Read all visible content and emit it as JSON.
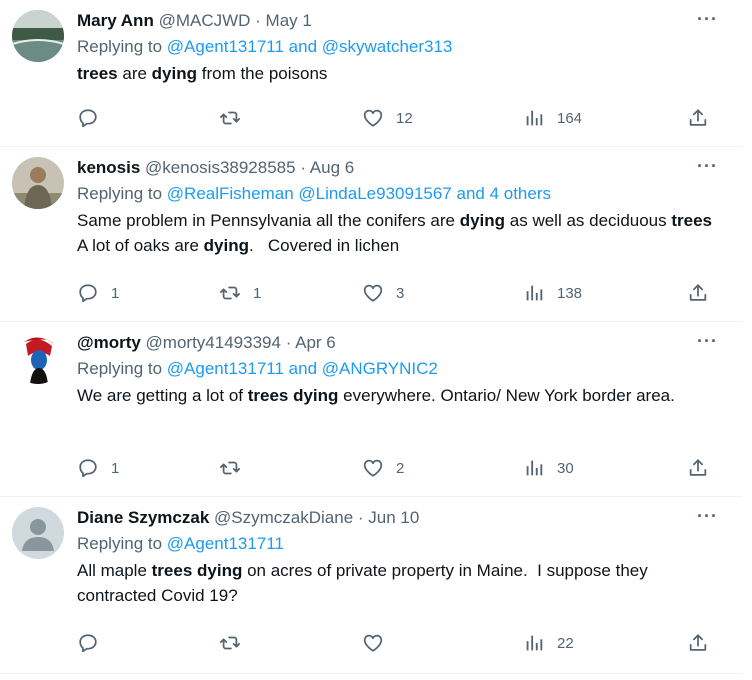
{
  "tweets": [
    {
      "name": "Mary Ann",
      "handle": "@MACJWD",
      "date": "· May 1",
      "replying_label": "Replying to ",
      "replying_to": "@Agent131711 and @skywatcher313",
      "text_parts": [
        {
          "t": "trees",
          "bold": true
        },
        {
          "t": " are ",
          "bold": false
        },
        {
          "t": "dying",
          "bold": true
        },
        {
          "t": " from the poisons",
          "bold": false
        }
      ],
      "counts": {
        "replies": "",
        "retweets": "",
        "likes": "12",
        "views": "164"
      },
      "avatar_style": "landscape"
    },
    {
      "name": "kenosis",
      "handle": "@kenosis38928585",
      "date": "· Aug 6",
      "replying_label": "Replying to ",
      "replying_to": "@RealFisheman @LindaLe93091567 and 4 others",
      "text_parts": [
        {
          "t": "Same problem in Pennsylvania all the conifers are ",
          "bold": false
        },
        {
          "t": "dying",
          "bold": true
        },
        {
          "t": " as well as deciduous ",
          "bold": false
        },
        {
          "t": "trees",
          "bold": true
        },
        {
          "t": "    A lot of oaks are ",
          "bold": false
        },
        {
          "t": "dying",
          "bold": true
        },
        {
          "t": ".   Covered in lichen",
          "bold": false
        }
      ],
      "counts": {
        "replies": "1",
        "retweets": "1",
        "likes": "3",
        "views": "138"
      },
      "avatar_style": "person"
    },
    {
      "name": "@morty",
      "handle": "@morty41493394",
      "date": "· Apr 6",
      "replying_label": "Replying to ",
      "replying_to": "@Agent131711 and @ANGRYNIC2",
      "text_parts": [
        {
          "t": "We are getting a lot of ",
          "bold": false
        },
        {
          "t": "trees dying",
          "bold": true
        },
        {
          "t": " everywhere. Ontario/ New York border area.",
          "bold": false
        }
      ],
      "counts": {
        "replies": "1",
        "retweets": "",
        "likes": "2",
        "views": "30"
      },
      "avatar_style": "character"
    },
    {
      "name": "Diane Szymczak",
      "handle": "@SzymczakDiane",
      "date": "· Jun 10",
      "replying_label": "Replying to ",
      "replying_to": "@Agent131711",
      "text_parts": [
        {
          "t": "All maple ",
          "bold": false
        },
        {
          "t": "trees dying",
          "bold": true
        },
        {
          "t": " on acres of private property in Maine.  I suppose they contracted Covid 19?",
          "bold": false
        }
      ],
      "counts": {
        "replies": "",
        "retweets": "",
        "likes": "",
        "views": "22"
      },
      "avatar_style": "default"
    }
  ],
  "more_glyph": "···",
  "colors": {
    "link": "#1d9bf0",
    "muted": "#536471",
    "text": "#0f1419",
    "divider": "#eff3f4"
  },
  "icons": [
    "reply-icon",
    "retweet-icon",
    "like-icon",
    "views-icon",
    "share-icon",
    "more-icon"
  ]
}
